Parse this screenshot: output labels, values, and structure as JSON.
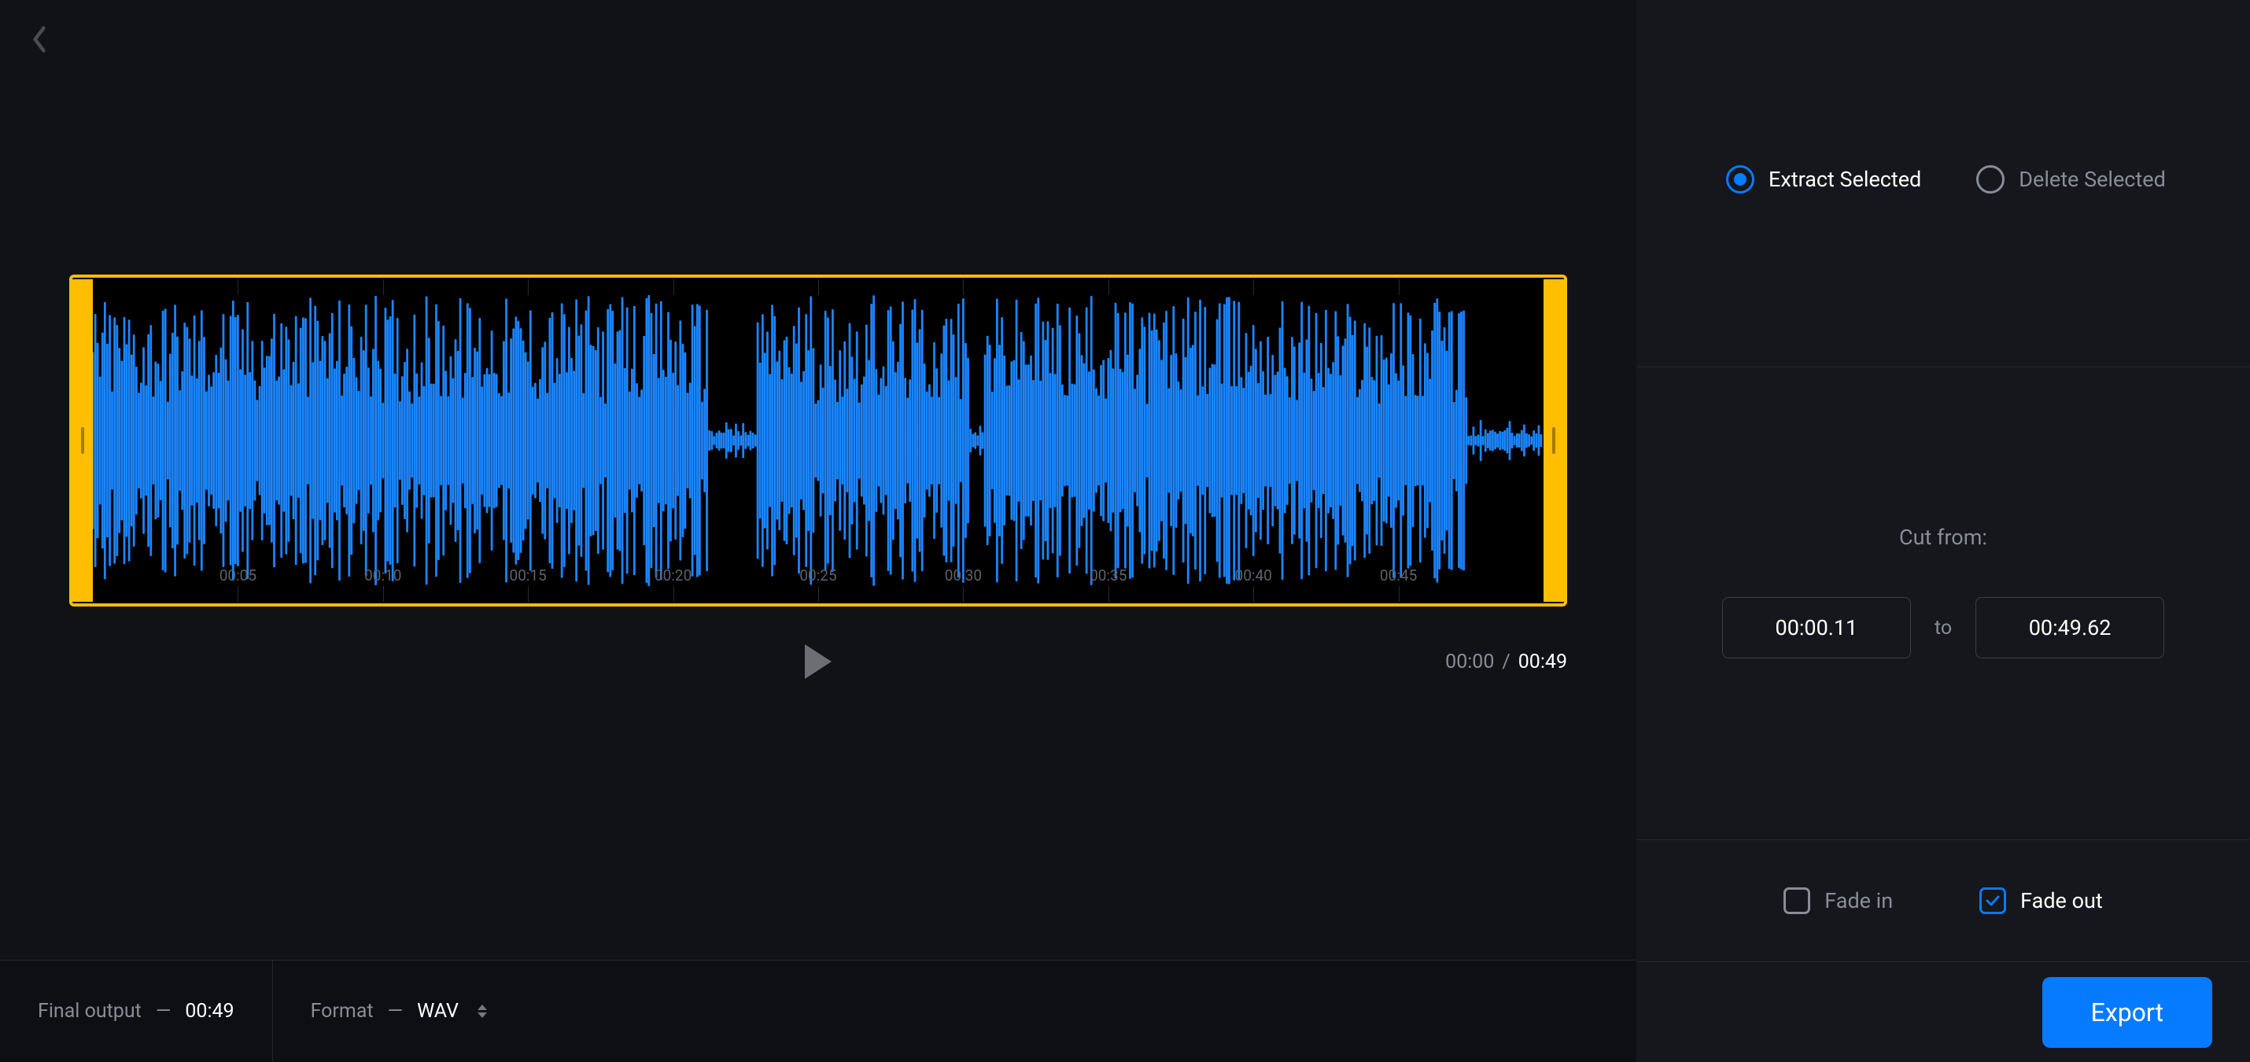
{
  "timeline": {
    "ticks": [
      "00:05",
      "00:10",
      "00:15",
      "00:20",
      "00:25",
      "00:30",
      "00:35",
      "00:40",
      "00:45"
    ]
  },
  "transport": {
    "current": "00:00",
    "separator": "/",
    "total": "00:49"
  },
  "footer": {
    "output_label": "Final output",
    "output_value": "00:49",
    "format_label": "Format",
    "format_value": "WAV"
  },
  "sidebar": {
    "mode_extract": "Extract Selected",
    "mode_delete": "Delete Selected",
    "cut_label": "Cut from:",
    "cut_from": "00:00.11",
    "cut_to_label": "to",
    "cut_to": "00:49.62",
    "fade_in": "Fade in",
    "fade_out": "Fade out",
    "export": "Export"
  }
}
